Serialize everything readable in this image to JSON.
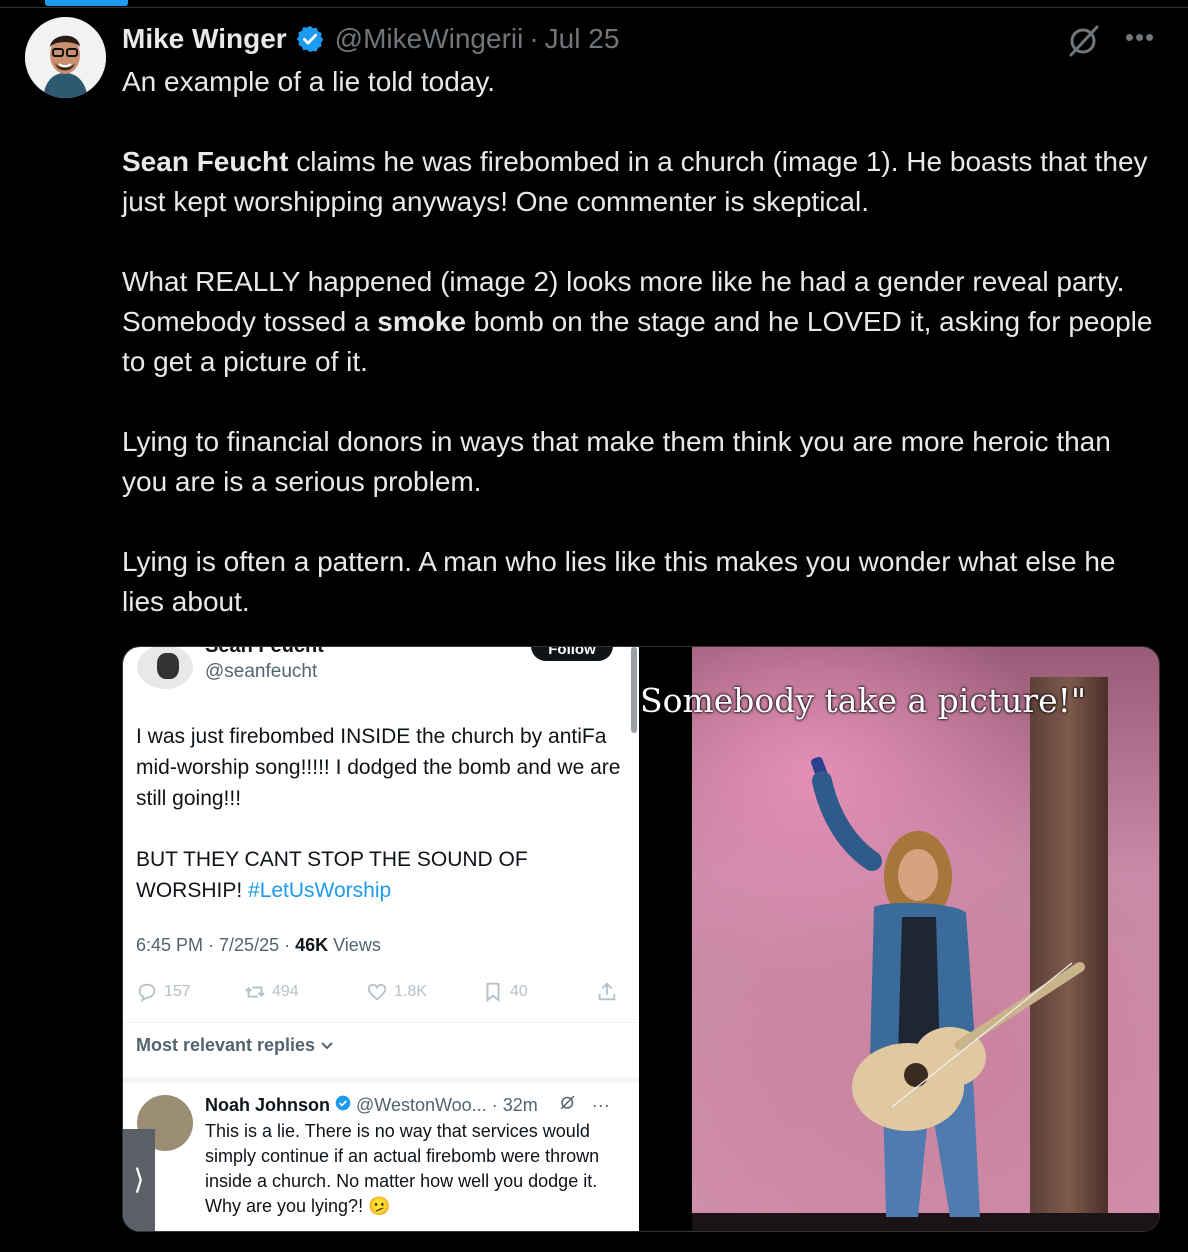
{
  "tweet": {
    "author_name": "Mike Winger",
    "author_handle": "@MikeWingerii",
    "separator": "·",
    "date": "Jul 25",
    "paragraphs": [
      {
        "plain": "An example of a lie told today."
      },
      {
        "bold1": "Sean Feucht",
        "rest1": " claims he was firebombed in a church (image 1). He boasts that they just kept worshipping anyways! One commenter is skeptical."
      },
      {
        "pre2": "What REALLY happened (image 2) looks more like he had a gender reveal party. Somebody tossed a ",
        "bold2": "smoke",
        "post2": " bomb on the stage and he LOVED it, asking for people to get a picture of it."
      },
      {
        "plain": "Lying to financial donors in ways that make them think you are more heroic than you are is a serious problem."
      },
      {
        "plain": "Lying is often a pattern. A man who lies like this makes you wonder what else he lies about."
      }
    ]
  },
  "icons": {
    "verified": "verified-badge-icon",
    "grok": "grok-icon",
    "more": "more-icon"
  },
  "colors": {
    "background": "#000000",
    "text": "#e7e9ea",
    "muted": "#71767b",
    "accent": "#1d9bf0"
  },
  "image1": {
    "name": "Sean Feucht",
    "handle": "@seanfeucht",
    "follow": "Follow",
    "text_p1": "I was just firebombed INSIDE the church by antiFa mid-worship song!!!!! I dodged the bomb and we are still going!!!",
    "text_p2": "BUT THEY CANT STOP THE SOUND OF WORSHIP! ",
    "hashtag": "#LetUsWorship",
    "meta_time": "6:45 PM · 7/25/25 · ",
    "meta_views_count": "46K",
    "meta_views_label": " Views",
    "replies": "157",
    "reposts": "494",
    "likes": "1.8K",
    "bookmarks": "40",
    "most_relevant": "Most relevant replies",
    "reply": {
      "name": "Noah Johnson",
      "handle": "@WestonWoo...",
      "time": "· 32m",
      "text": "This is a lie. There is no way that services would simply continue if an actual firebomb were thrown inside a church. No matter how well you dodge it. Why are you lying?! 🫤"
    },
    "nav_arrow": "⟩"
  },
  "image2": {
    "caption": "Somebody take a picture!\""
  }
}
